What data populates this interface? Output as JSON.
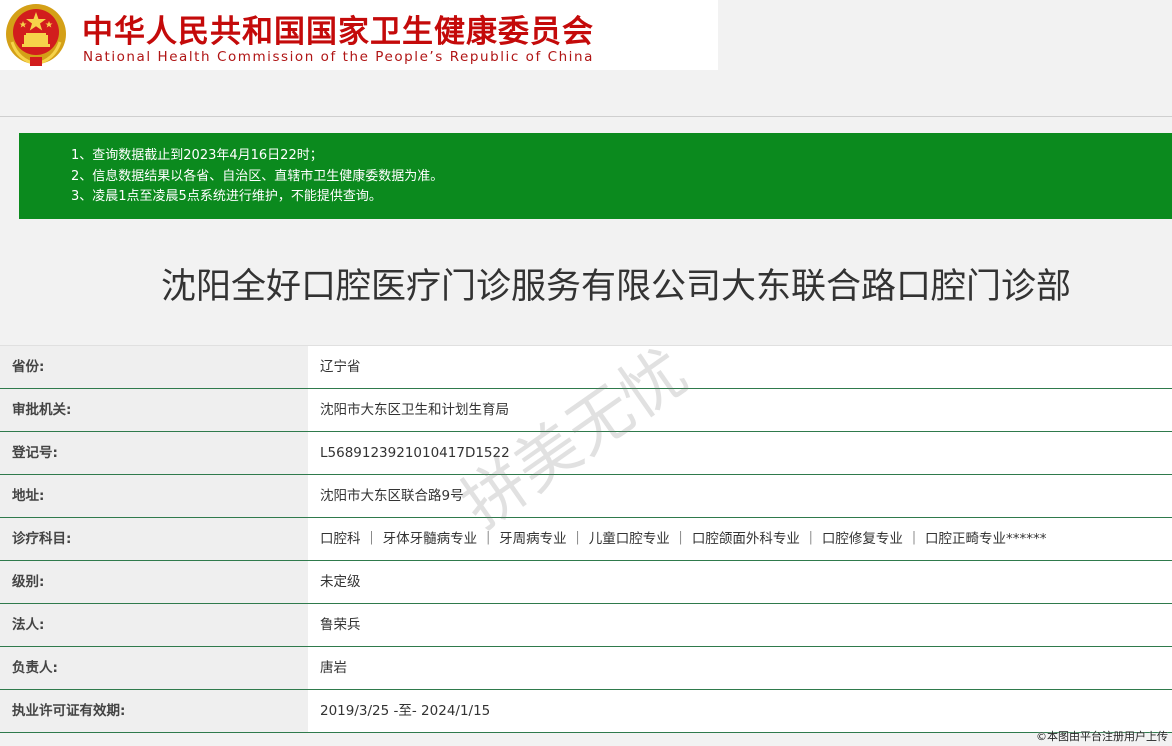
{
  "header": {
    "title_cn": "中华人民共和国国家卫生健康委员会",
    "title_en": "National Health Commission of the People’s Republic of China",
    "emblem_icon": "national-emblem-icon"
  },
  "notice": {
    "lines": [
      "1、查询数据截止到2023年4月16日22时；",
      "2、信息数据结果以各省、自治区、直辖市卫生健康委数据为准。",
      "3、凌晨1点至凌晨5点系统进行维护，不能提供查询。"
    ],
    "background_color": "#0b8a1e"
  },
  "clinic": {
    "name": "沈阳全好口腔医疗门诊服务有限公司大东联合路口腔门诊部"
  },
  "details": [
    {
      "label": "省份:",
      "value": "辽宁省"
    },
    {
      "label": "审批机关:",
      "value": "沈阳市大东区卫生和计划生育局"
    },
    {
      "label": "登记号:",
      "value": "L5689123921010417D1522"
    },
    {
      "label": "地址:",
      "value": "沈阳市大东区联合路9号"
    },
    {
      "label": "诊疗科目:",
      "value": "口腔科 ｜ 牙体牙髓病专业 ｜ 牙周病专业 ｜ 儿童口腔专业 ｜ 口腔颌面外科专业 ｜ 口腔修复专业 ｜ 口腔正畸专业******"
    },
    {
      "label": "级别:",
      "value": "未定级"
    },
    {
      "label": "法人:",
      "value": "鲁荣兵"
    },
    {
      "label": "负责人:",
      "value": "唐岩"
    },
    {
      "label": "执业许可证有效期:",
      "value": "2019/3/25 -至- 2024/1/15"
    }
  ],
  "watermark": "拼美无忧",
  "credit": "©本图由平台注册用户上传"
}
